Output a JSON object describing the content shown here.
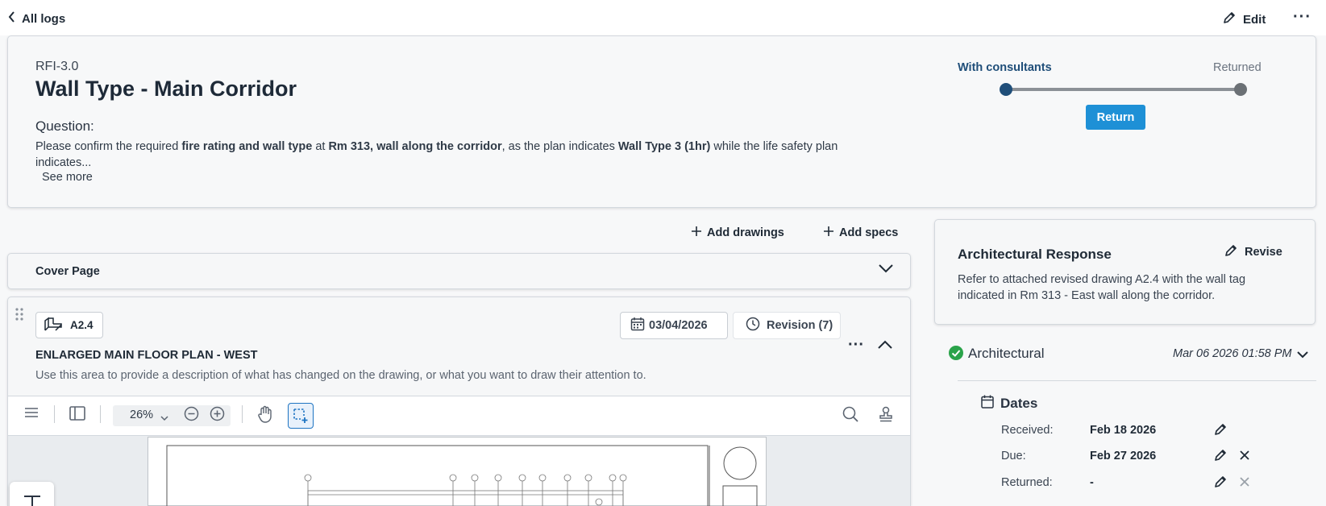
{
  "topbar": {
    "back_label": "All logs",
    "edit_label": "Edit"
  },
  "rfi": {
    "number": "RFI-3.0",
    "title": "Wall Type - Main Corridor",
    "question_label": "Question:",
    "question_parts": [
      {
        "text": "Please confirm the required ",
        "bold": false
      },
      {
        "text": "fire rating and wall type",
        "bold": true
      },
      {
        "text": " at ",
        "bold": false
      },
      {
        "text": "Rm 313, wall along the corridor",
        "bold": true
      },
      {
        "text": ", as the plan indicates ",
        "bold": false
      },
      {
        "text": "Wall Type 3 (1hr)",
        "bold": true
      },
      {
        "text": " while the life safety plan indicates...",
        "bold": false
      }
    ],
    "see_more_label": "See more"
  },
  "status": {
    "from_label": "With consultants",
    "to_label": "Returned",
    "return_button": "Return",
    "colors": {
      "active": "#1f4e79",
      "inactive": "#6b7075",
      "button": "#1e90d6"
    }
  },
  "actions": {
    "add_drawings": "Add drawings",
    "add_specs": "Add specs"
  },
  "cover": {
    "label": "Cover Page"
  },
  "drawing": {
    "sheet_number": "A2.4",
    "date": "03/04/2026",
    "revision": "Revision (7)",
    "title": "ENLARGED MAIN FLOOR PLAN - WEST",
    "description": "Use this area to provide a description of what has changed on the drawing, or what you want to draw their attention to."
  },
  "viewer": {
    "zoom": "26%"
  },
  "response": {
    "title": "Architectural Response",
    "revise_label": "Revise",
    "text": "Refer to attached revised drawing A2.4 with the wall tag indicated in Rm 313 - East wall along the corridor."
  },
  "discipline": {
    "label": "Architectural",
    "timestamp": "Mar 06 2026 01:58 PM",
    "status_color": "#2aa34a"
  },
  "dates": {
    "heading": "Dates",
    "rows": [
      {
        "label": "Received:",
        "value": "Feb 18 2026"
      },
      {
        "label": "Due:",
        "value": "Feb 27 2026"
      },
      {
        "label": "Returned:",
        "value": "-"
      }
    ]
  }
}
